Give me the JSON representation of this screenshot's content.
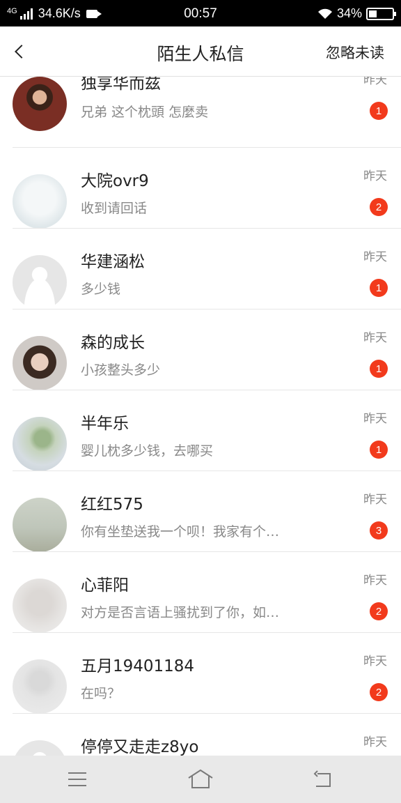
{
  "status_bar": {
    "network": "4G",
    "speed": "34.6K/s",
    "time": "00:57",
    "battery": "34%",
    "battery_level": 0.34
  },
  "header": {
    "title": "陌生人私信",
    "action": "忽略未读"
  },
  "conversations": [
    {
      "name": "独享华而兹",
      "preview": "兄弟 这个枕頭 怎麼卖",
      "time": "昨天",
      "badge": "1"
    },
    {
      "name": "大院ovr9",
      "preview": "收到请回话",
      "time": "昨天",
      "badge": "2"
    },
    {
      "name": "华建涵松",
      "preview": "多少钱",
      "time": "昨天",
      "badge": "1"
    },
    {
      "name": "森的成长",
      "preview": "小孩整头多少",
      "time": "昨天",
      "badge": "1"
    },
    {
      "name": "半年乐",
      "preview": "婴儿枕多少钱，去哪买",
      "time": "昨天",
      "badge": "1"
    },
    {
      "name": "红红575",
      "preview": "你有坐垫送我一个呗！我家有个…",
      "time": "昨天",
      "badge": "3"
    },
    {
      "name": "心菲阳",
      "preview": "对方是否言语上骚扰到了你，如…",
      "time": "昨天",
      "badge": "2"
    },
    {
      "name": "五月19401184",
      "preview": "在吗？",
      "time": "昨天",
      "badge": "2"
    },
    {
      "name": "停停又走走z8yo",
      "preview": "",
      "time": "昨天",
      "badge": ""
    }
  ],
  "colors": {
    "badge": "#f23a1c",
    "text_primary": "#222222",
    "text_secondary": "#888888"
  }
}
